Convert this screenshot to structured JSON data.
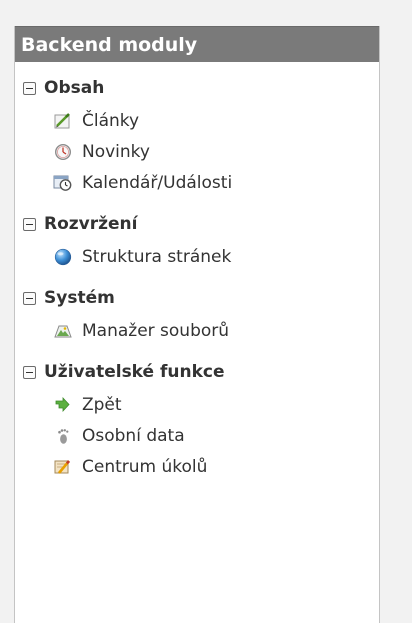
{
  "panel": {
    "title": "Backend moduly"
  },
  "groups": [
    {
      "label": "Obsah",
      "items": [
        {
          "label": "Články",
          "icon": "pencil-paper-icon"
        },
        {
          "label": "Novinky",
          "icon": "clock-icon"
        },
        {
          "label": "Kalendář/Události",
          "icon": "calendar-clock-icon"
        }
      ]
    },
    {
      "label": "Rozvržení",
      "items": [
        {
          "label": "Struktura stránek",
          "icon": "globe-icon"
        }
      ]
    },
    {
      "label": "Systém",
      "items": [
        {
          "label": "Manažer souborů",
          "icon": "image-file-icon"
        }
      ]
    },
    {
      "label": "Uživatelské funkce",
      "items": [
        {
          "label": "Zpět",
          "icon": "green-arrow-icon"
        },
        {
          "label": "Osobní data",
          "icon": "footprint-icon"
        },
        {
          "label": "Centrum úkolů",
          "icon": "task-pencil-icon"
        }
      ]
    }
  ]
}
